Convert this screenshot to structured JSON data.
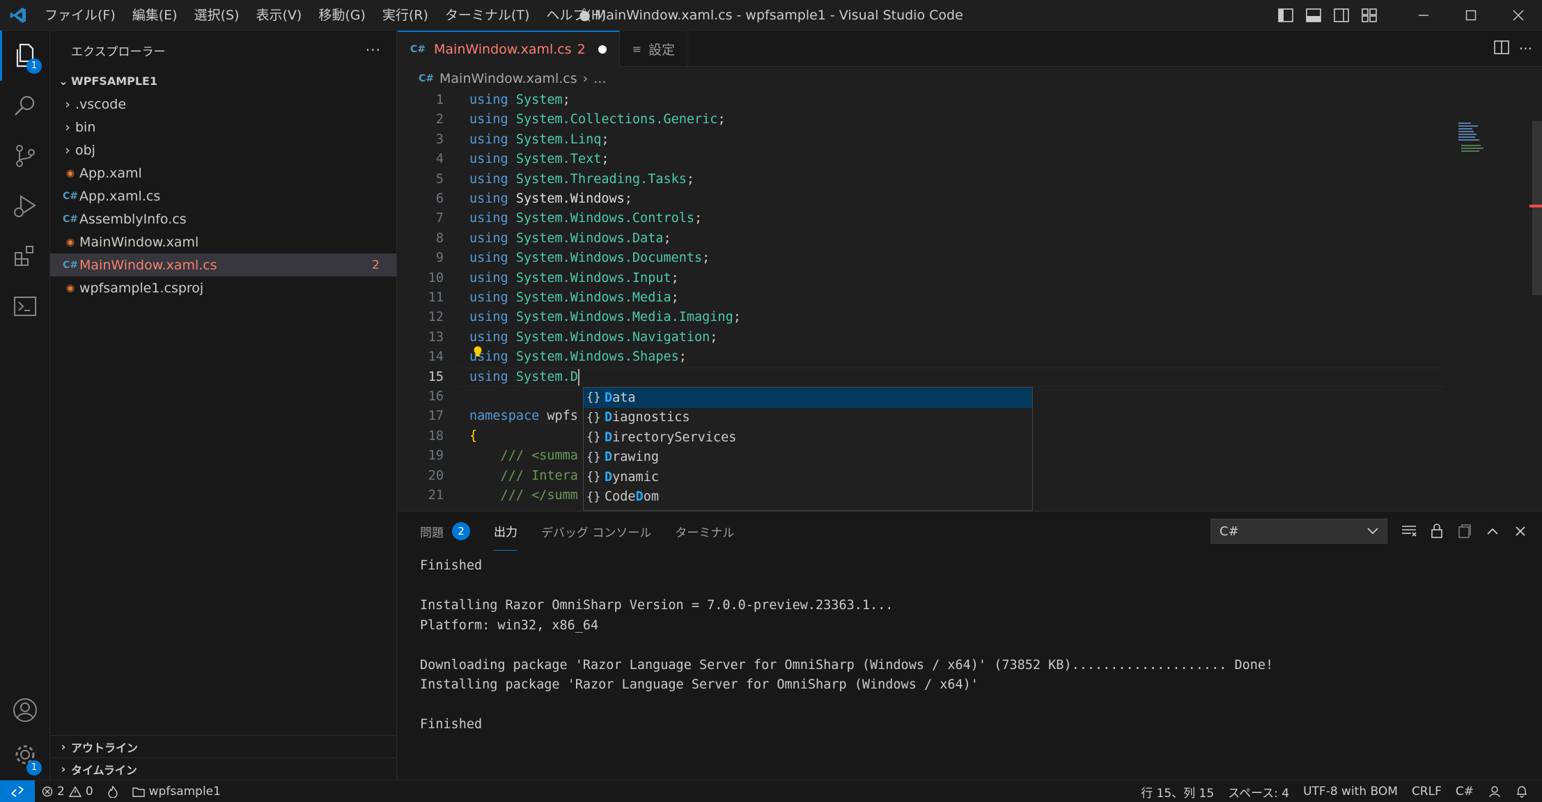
{
  "window": {
    "title": "● MainWindow.xaml.cs - wpfsample1 - Visual Studio Code"
  },
  "menu": [
    "ファイル(F)",
    "編集(E)",
    "選択(S)",
    "表示(V)",
    "移動(G)",
    "実行(R)",
    "ターミナル(T)",
    "ヘルプ(H)"
  ],
  "activity": {
    "explorer_badge": "1",
    "settings_badge": "1"
  },
  "sidebar": {
    "title": "エクスプローラー",
    "more": "···",
    "root": "WPFSAMPLE1",
    "items": [
      {
        "label": ".vscode",
        "type": "folder"
      },
      {
        "label": "bin",
        "type": "folder"
      },
      {
        "label": "obj",
        "type": "folder"
      },
      {
        "label": "App.xaml",
        "type": "xaml"
      },
      {
        "label": "App.xaml.cs",
        "type": "cs"
      },
      {
        "label": "AssemblyInfo.cs",
        "type": "cs"
      },
      {
        "label": "MainWindow.xaml",
        "type": "xaml"
      },
      {
        "label": "MainWindow.xaml.cs",
        "type": "cs",
        "badge": "2"
      },
      {
        "label": "wpfsample1.csproj",
        "type": "xaml"
      }
    ],
    "outline": "アウトライン",
    "timeline": "タイムライン"
  },
  "tabs": [
    {
      "label": "MainWindow.xaml.cs",
      "errors": "2"
    },
    {
      "label": "設定"
    }
  ],
  "breadcrumb": {
    "file": "MainWindow.xaml.cs",
    "rest": "..."
  },
  "code": {
    "current_line": 15,
    "lines": [
      {
        "n": "1",
        "kw": "using",
        "rest": " System;"
      },
      {
        "n": "2",
        "kw": "using",
        "rest": " System.Collections.Generic;"
      },
      {
        "n": "3",
        "kw": "using",
        "rest": " System.Linq;"
      },
      {
        "n": "4",
        "kw": "using",
        "rest": " System.Text;"
      },
      {
        "n": "5",
        "kw": "using",
        "rest": " System.Threading.Tasks;"
      },
      {
        "n": "6",
        "kw": "using",
        "rest": " System.Windows;"
      },
      {
        "n": "7",
        "kw": "using",
        "rest": " System.Windows.Controls;"
      },
      {
        "n": "8",
        "kw": "using",
        "rest": " System.Windows.Data;"
      },
      {
        "n": "9",
        "kw": "using",
        "rest": " System.Windows.Documents;"
      },
      {
        "n": "10",
        "kw": "using",
        "rest": " System.Windows.Input;"
      },
      {
        "n": "11",
        "kw": "using",
        "rest": " System.Windows.Media;"
      },
      {
        "n": "12",
        "kw": "using",
        "rest": " System.Windows.Media.Imaging;"
      },
      {
        "n": "13",
        "kw": "using",
        "rest": " System.Windows.Navigation;"
      },
      {
        "n": "14",
        "kw": "using",
        "rest": " System.Windows.Shapes;"
      },
      {
        "n": "15",
        "kw": "using",
        "rest": " System.D"
      },
      {
        "n": "16",
        "kw": "",
        "rest": ""
      },
      {
        "n": "17",
        "kw": "namespace",
        "rest": " wpfs"
      },
      {
        "n": "18",
        "kw": "",
        "rest": "{"
      },
      {
        "n": "19",
        "kw": "",
        "rest": "    /// <summa"
      },
      {
        "n": "20",
        "kw": "",
        "rest": "    /// Intera"
      },
      {
        "n": "21",
        "kw": "",
        "rest": "    /// </summ"
      }
    ]
  },
  "suggest": [
    {
      "icon": "{}",
      "match": "D",
      "rest": "ata"
    },
    {
      "icon": "{}",
      "match": "D",
      "rest": "iagnostics"
    },
    {
      "icon": "{}",
      "match": "D",
      "rest": "irectoryServices"
    },
    {
      "icon": "{}",
      "match": "D",
      "rest": "rawing"
    },
    {
      "icon": "{}",
      "match": "D",
      "rest": "ynamic"
    },
    {
      "icon": "{}",
      "pre": "Code",
      "match": "D",
      "rest": "om"
    }
  ],
  "panel": {
    "tabs": [
      {
        "label": "問題",
        "badge": "2"
      },
      {
        "label": "出力"
      },
      {
        "label": "デバッグ コンソール"
      },
      {
        "label": "ターミナル"
      }
    ],
    "output_channel": "C#",
    "output": [
      "Finished",
      "",
      "Installing Razor OmniSharp Version = 7.0.0-preview.23363.1...",
      "Platform: win32, x86_64",
      "",
      "Downloading package 'Razor Language Server for OmniSharp (Windows / x64)' (73852 KB).................... Done!",
      "Installing package 'Razor Language Server for OmniSharp (Windows / x64)'",
      "",
      "Finished"
    ]
  },
  "status": {
    "errors": "2",
    "warnings": "0",
    "folder": "wpfsample1",
    "position": "行 15、列 15",
    "spaces": "スペース: 4",
    "encoding": "UTF-8 with BOM",
    "eol": "CRLF",
    "language": "C#"
  },
  "colors": {
    "accent": "#0078d4",
    "error": "#f88070",
    "keyword": "#569cd6",
    "type": "#4ec9b0"
  }
}
